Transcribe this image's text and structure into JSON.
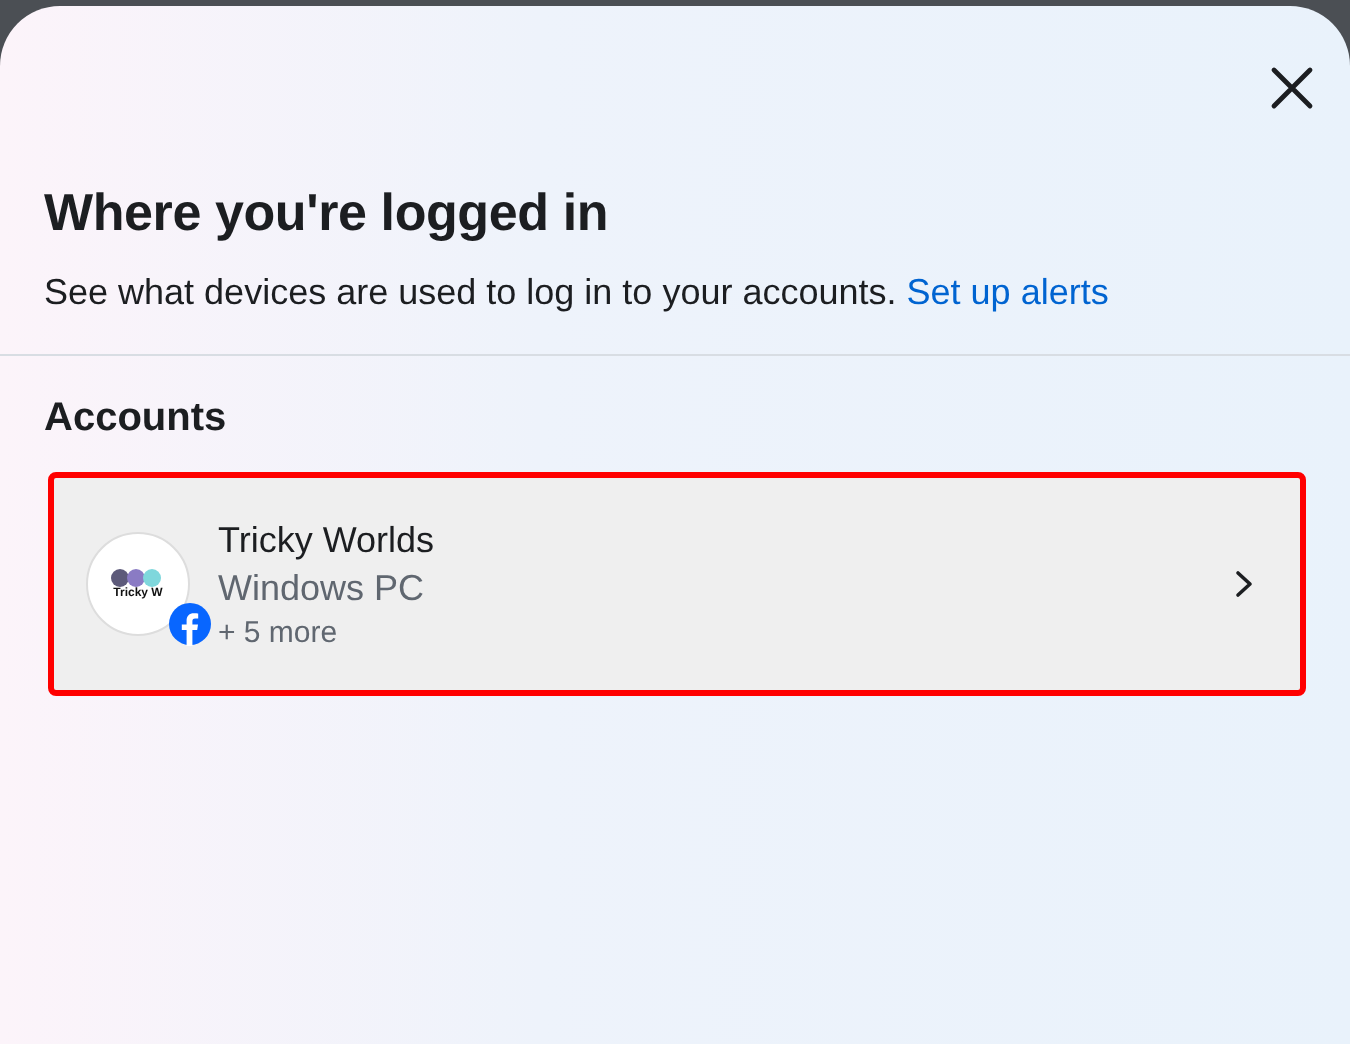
{
  "dialog": {
    "title": "Where you're logged in",
    "description": "See what devices are used to log in to your accounts.",
    "link": "Set up alerts"
  },
  "section": {
    "heading": "Accounts"
  },
  "accounts": [
    {
      "avatar_text": "Tricky W",
      "name": "Tricky Worlds",
      "device": "Windows PC",
      "more": "+ 5 more",
      "highlighted": true
    }
  ]
}
